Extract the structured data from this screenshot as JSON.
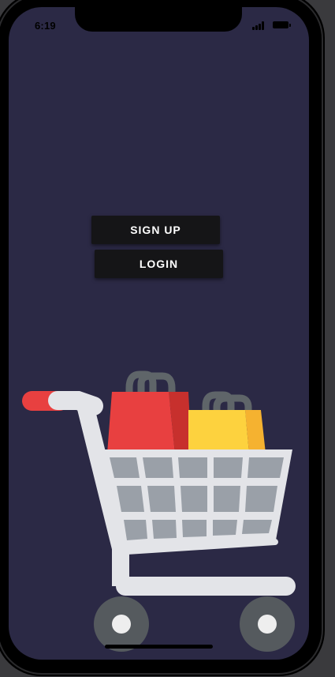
{
  "status_bar": {
    "time": "6:19",
    "signal_icon": "cellular-signal-icon",
    "battery_icon": "battery-full-icon"
  },
  "auth": {
    "signup_label": "SIGN UP",
    "login_label": "LOGIN"
  },
  "illustration": {
    "name": "shopping-cart-illustration"
  },
  "colors": {
    "screen_background": "#2b2945",
    "button_background": "#151517",
    "button_text": "#ffffff",
    "bag_red": "#e84040",
    "bag_yellow": "#fdd23e",
    "cart_frame": "#e3e4e8",
    "cart_basket": "#9aa0a8",
    "wheel": "#555a5e"
  }
}
